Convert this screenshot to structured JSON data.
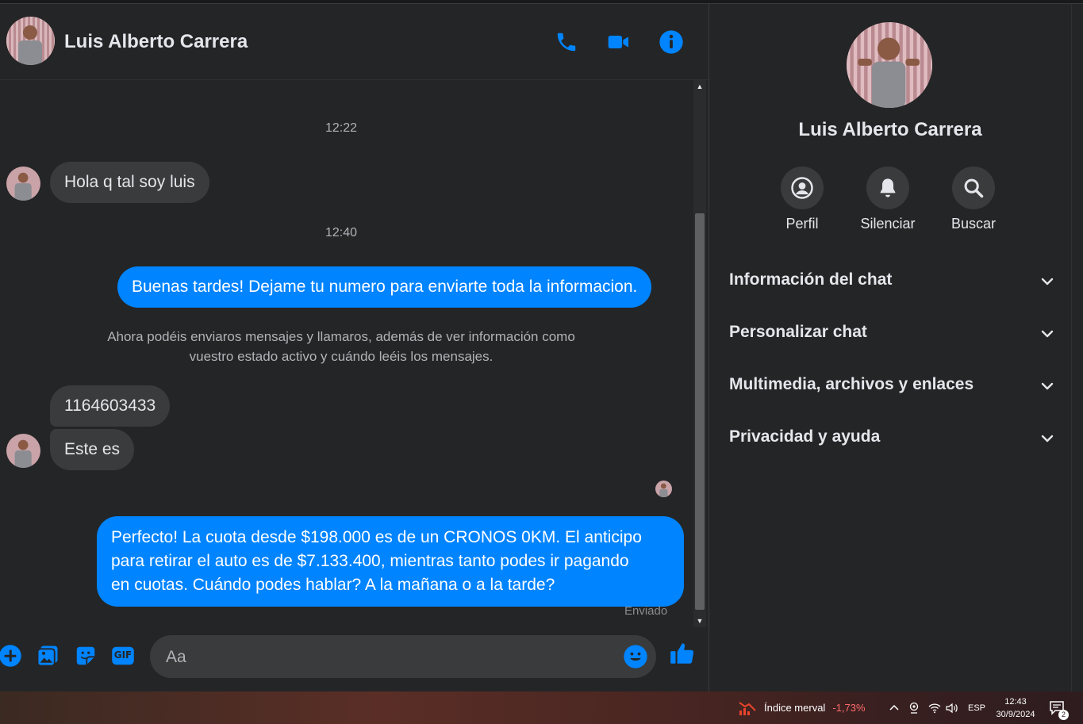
{
  "contact": {
    "name": "Luis Alberto Carrera"
  },
  "header": {
    "call_icon": "phone-icon",
    "video_icon": "video-camera-icon",
    "info_icon": "info-icon"
  },
  "conversation": {
    "time_1": "12:22",
    "msg_in_1": "Hola q tal soy luis",
    "time_2": "12:40",
    "msg_out_1": "Buenas tardes! Dejame tu numero para enviarte toda la informacion.",
    "system_note_line1": "Ahora podéis enviaros mensajes y llamaros, además de ver información como",
    "system_note_line2": "vuestro estado activo y cuándo leéis los mensajes.",
    "msg_in_2": "1164603433",
    "msg_in_3": "Este es",
    "msg_out_2_line1": "Perfecto! La cuota desde $198.000 es de un CRONOS 0KM. El anticipo",
    "msg_out_2_line2": "para retirar el auto es de $7.133.400, mientras tanto podes ir pagando",
    "msg_out_2_line3": "en cuotas. Cuándo podes hablar? A la mañana o a la tarde?",
    "status": "Enviado"
  },
  "composer": {
    "placeholder": "Aa",
    "icons": [
      "plus-icon",
      "image-icon",
      "sticker-icon",
      "gif-icon",
      "emoji-icon",
      "thumbs-up-icon"
    ],
    "gif_label": "GIF"
  },
  "panel": {
    "name": "Luis Alberto Carrera",
    "actions": [
      {
        "label": "Perfil",
        "icon": "profile-icon"
      },
      {
        "label": "Silenciar",
        "icon": "bell-icon"
      },
      {
        "label": "Buscar",
        "icon": "search-icon"
      }
    ],
    "sections": [
      {
        "label": "Información del chat"
      },
      {
        "label": "Personalizar chat"
      },
      {
        "label": "Multimedia, archivos y enlaces"
      },
      {
        "label": "Privacidad y ayuda"
      }
    ]
  },
  "taskbar": {
    "widget_label": "Índice merval",
    "widget_value": "-1,73%",
    "language": "ESP",
    "time": "12:43",
    "date": "30/9/2024",
    "notification_count": "2"
  },
  "colors": {
    "accent": "#0084ff",
    "bubble_in": "#3a3b3c",
    "background": "#242526",
    "negative": "#ff6b6b"
  }
}
